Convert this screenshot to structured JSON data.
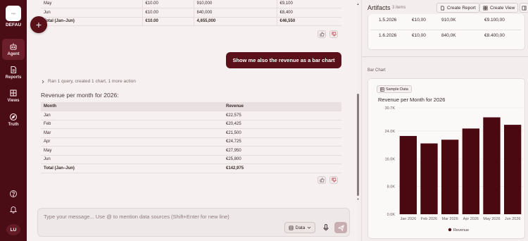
{
  "sidebar": {
    "org_label": "DEFAU",
    "logo_text": "logo",
    "items": [
      {
        "label": "Agent",
        "icon": "robot-icon"
      },
      {
        "label": "Reports",
        "icon": "reports-icon"
      },
      {
        "label": "Views",
        "icon": "views-icon"
      },
      {
        "label": "Truth",
        "icon": "compass-icon"
      }
    ],
    "avatar_initials": "LU"
  },
  "chat": {
    "prev_table": {
      "rows": [
        [
          "May",
          "€10.00",
          "910,000",
          "€9,100"
        ],
        [
          "Jun",
          "€10.00",
          "840,000",
          "€8,400"
        ],
        [
          "Total (Jan–Jun)",
          "€10.00",
          "4,655,000",
          "€46,550"
        ]
      ]
    },
    "user_message": "Show me also the revenue as a bar chart",
    "ran_line": "Ran 1 query, created 1 chart, 1 more action",
    "heading": "Revenue per month for 2026:",
    "table": {
      "headers": [
        "Month",
        "Revenue"
      ],
      "rows": [
        [
          "Jan",
          "€22,575"
        ],
        [
          "Feb",
          "€20,425"
        ],
        [
          "Mar",
          "€21,500"
        ],
        [
          "Apr",
          "€24,725"
        ],
        [
          "May",
          "€27,950"
        ],
        [
          "Jun",
          "€25,800"
        ],
        [
          "Total (Jan–Jun)",
          "€142,975"
        ]
      ]
    },
    "input_placeholder": "Type your message... Use @ to mention data sources (Shift+Enter for new line)",
    "data_button_label": "Data"
  },
  "artifacts": {
    "title": "Artifacts",
    "count": "3 items",
    "create_report_label": "Create Report",
    "create_view_label": "Create View",
    "table_rows": [
      [
        "1.5.2026",
        "€10,00",
        "910,0K",
        "€9.100,00"
      ],
      [
        "1.6.2026",
        "€10,00",
        "840,0K",
        "€8.400,00"
      ]
    ],
    "chart_section_label": "Bar Chart",
    "sample_badge": "Sample Data"
  },
  "chart_data": {
    "type": "bar",
    "title": "Revenue per Month for 2026",
    "categories": [
      "Jan 2026",
      "Feb 2026",
      "Mar 2026",
      "Apr 2026",
      "May 2026",
      "Jun 2026"
    ],
    "series": [
      {
        "name": "Revenue",
        "values": [
          22575,
          20425,
          21500,
          24725,
          27950,
          25800
        ]
      }
    ],
    "ylim": [
      0,
      30700
    ],
    "yticks": [
      "0.0K",
      "8.0K",
      "16.0K",
      "24.0K",
      "30.7K"
    ],
    "ytick_values": [
      0,
      8000,
      16000,
      24000,
      30700
    ],
    "bar_color": "#4a0810",
    "legend_position": "bottom"
  }
}
